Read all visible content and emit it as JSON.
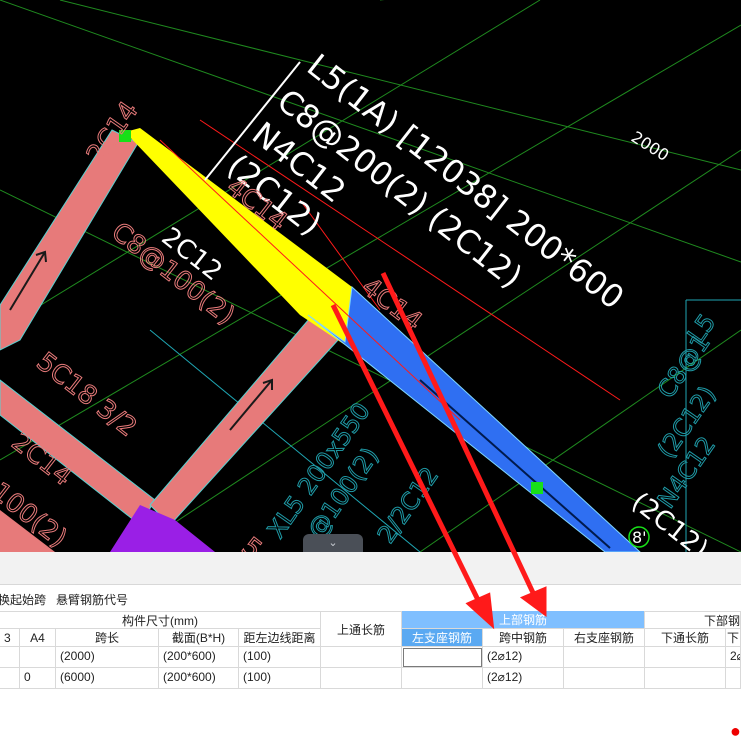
{
  "cad": {
    "beam_label_lines": [
      "L5(1A) [12038] 200*600",
      "C8@200(2) (2C12)",
      "N4C12",
      "(2C12)"
    ],
    "left_top_label": "2C14",
    "upper_left_label": "4C14",
    "mid_label": "2C12",
    "left_beam_stirrup": "C8@100(2)",
    "left_beam_bottom": "5C18 3/2",
    "left_beam_2c14": "2C14",
    "left_beam_100": "100(2)",
    "right_4c14": "4C14",
    "xl_label": "XL5 200x550",
    "xl_sub1": "@100(2)",
    "xl_sub2": "2/2C12",
    "dim_2000": "2000",
    "right_l5": "L5",
    "right_c8": "C8@1",
    "right_2c12a": "(2C12)",
    "right_n4c12": "N4C12",
    "right_2c12b": "(2C12)",
    "marker_8": "8'",
    "left_fragment": "5"
  },
  "collapse_tab": {
    "icon": "chevron-down-icon",
    "glyph": "⌄"
  },
  "toolbar": {
    "item1": "换起始跨",
    "item2": "悬臂钢筋代号"
  },
  "table": {
    "group_size": "构件尺寸(mm)",
    "group_top": "上部钢筋",
    "group_bottom": "下部钢",
    "headers": {
      "a3": "3",
      "a4": "A4",
      "span": "跨长",
      "section": "截面(B*H)",
      "offset": "距左边线距离",
      "top_through": "上通长筋",
      "left_support": "左支座钢筋",
      "mid_span": "跨中钢筋",
      "right_support": "右支座钢筋",
      "bottom_through": "下通长筋",
      "last": "下"
    },
    "rows": [
      {
        "a3": "",
        "a4": "",
        "span": "(2000)",
        "section": "(200*600)",
        "offset": "(100)",
        "top_through": "",
        "left_support": "",
        "mid_span": "(2⌀12)",
        "right_support": "",
        "bottom_through": "",
        "last": "2⌀"
      },
      {
        "a3": "",
        "a4": "0",
        "span": "(6000)",
        "section": "(200*600)",
        "offset": "(100)",
        "top_through": "",
        "left_support": "",
        "mid_span": "(2⌀12)",
        "right_support": "",
        "bottom_through": "",
        "last": ""
      }
    ]
  },
  "colors": {
    "beam_pink": "#e77a7a",
    "beam_yellow": "#ffff00",
    "beam_blue": "#2f6ff2",
    "beam_purple": "#9a1fe6",
    "grid_green": "#1f8a1f",
    "cyan_text": "#1f9aa6",
    "arrow_red": "#ff1a1a",
    "header_blue": "#7fbfff"
  }
}
